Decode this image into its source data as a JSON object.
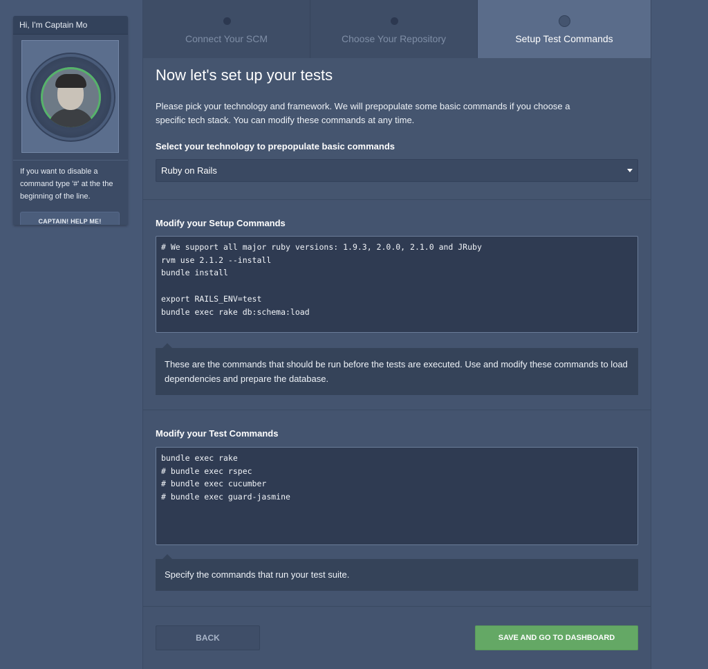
{
  "captain": {
    "greeting": "Hi, I'm Captain Mo",
    "tip": "If you want to disable a command type '#' at the the beginning of the line.",
    "help_button": "CAPTAIN! HELP ME!"
  },
  "steps": [
    {
      "label": "Connect Your SCM",
      "active": false
    },
    {
      "label": "Choose Your Repository",
      "active": false
    },
    {
      "label": "Setup Test Commands",
      "active": true
    }
  ],
  "main": {
    "title": "Now let's set up your tests",
    "intro": "Please pick your technology and framework. We will prepopulate some basic commands if you choose a specific tech stack. You can modify these commands at any time.",
    "technology_label": "Select your technology to prepopulate basic commands",
    "technology_selected": "Ruby on Rails"
  },
  "setup": {
    "label": "Modify your Setup Commands",
    "commands": "# We support all major ruby versions: 1.9.3, 2.0.0, 2.1.0 and JRuby\nrvm use 2.1.2 --install\nbundle install\n\nexport RAILS_ENV=test\nbundle exec rake db:schema:load",
    "hint": "These are the commands that should be run before the tests are executed. Use and modify these commands to load dependencies and prepare the database."
  },
  "test": {
    "label": "Modify your Test Commands",
    "commands": "bundle exec rake\n# bundle exec rspec\n# bundle exec cucumber\n# bundle exec guard-jasmine",
    "hint": "Specify the commands that run your test suite."
  },
  "footer": {
    "back": "BACK",
    "save": "SAVE AND GO TO DASHBOARD"
  },
  "colors": {
    "background": "#475875",
    "panel": "#44546f",
    "save_button": "#64a865"
  }
}
